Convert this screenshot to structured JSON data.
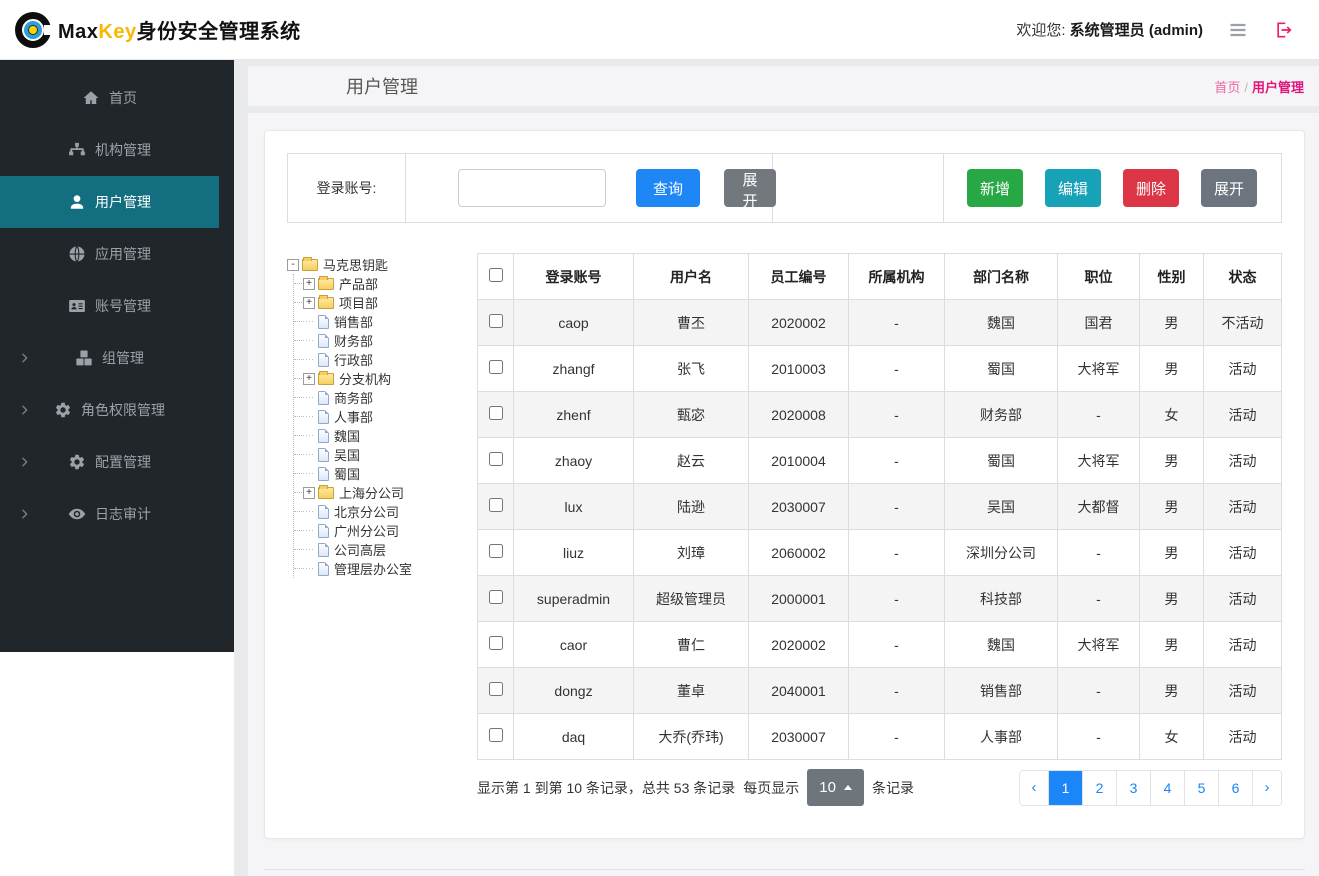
{
  "header": {
    "brand": {
      "max": "Max",
      "key": "Key",
      "suffix": "身份安全管理系统"
    },
    "welcome_label": "欢迎您:",
    "user_display": "系统管理员 (admin)"
  },
  "sidebar": {
    "active_color": "#136f80",
    "items": [
      {
        "name": "home",
        "label": "首页",
        "icon": "home-icon",
        "active": false,
        "chevron": false
      },
      {
        "name": "org",
        "label": "机构管理",
        "icon": "sitemap-icon",
        "active": false,
        "chevron": false
      },
      {
        "name": "user",
        "label": "用户管理",
        "icon": "user-icon",
        "active": true,
        "chevron": false
      },
      {
        "name": "app",
        "label": "应用管理",
        "icon": "globe-icon",
        "active": false,
        "chevron": false
      },
      {
        "name": "account",
        "label": "账号管理",
        "icon": "id-card-icon",
        "active": false,
        "chevron": false
      },
      {
        "name": "group",
        "label": "组管理",
        "icon": "cubes-icon",
        "active": false,
        "chevron": true
      },
      {
        "name": "role",
        "label": "角色权限管理",
        "icon": "gears-icon",
        "active": false,
        "chevron": true
      },
      {
        "name": "config",
        "label": "配置管理",
        "icon": "gears-icon",
        "active": false,
        "chevron": true
      },
      {
        "name": "audit",
        "label": "日志审计",
        "icon": "eye-icon",
        "active": false,
        "chevron": true
      }
    ]
  },
  "page": {
    "title": "用户管理",
    "breadcrumb": [
      "首页",
      "用户管理"
    ]
  },
  "search": {
    "label": "登录账号:",
    "input_value": "",
    "query_label": "查询",
    "toggle_label": "展开"
  },
  "toolbar": {
    "buttons": [
      {
        "name": "add-button",
        "label": "新增",
        "color": "#28a745"
      },
      {
        "name": "edit-button",
        "label": "编辑",
        "color": "#17a2b8"
      },
      {
        "name": "delete-button",
        "label": "删除",
        "color": "#dc3545"
      },
      {
        "name": "expand-button",
        "label": "展开",
        "color": "#6c757d"
      }
    ]
  },
  "tree": {
    "root": {
      "label": "马克思钥匙",
      "type": "folder",
      "expander": "minus"
    },
    "children": [
      {
        "label": "产品部",
        "type": "folder",
        "expander": "plus"
      },
      {
        "label": "项目部",
        "type": "folder",
        "expander": "plus"
      },
      {
        "label": "销售部",
        "type": "leaf",
        "expander": "none"
      },
      {
        "label": "财务部",
        "type": "leaf",
        "expander": "none"
      },
      {
        "label": "行政部",
        "type": "leaf",
        "expander": "none"
      },
      {
        "label": "分支机构",
        "type": "folder",
        "expander": "plus"
      },
      {
        "label": "商务部",
        "type": "leaf",
        "expander": "none"
      },
      {
        "label": "人事部",
        "type": "leaf",
        "expander": "none"
      },
      {
        "label": "魏国",
        "type": "leaf",
        "expander": "none"
      },
      {
        "label": "吴国",
        "type": "leaf",
        "expander": "none"
      },
      {
        "label": "蜀国",
        "type": "leaf",
        "expander": "none"
      },
      {
        "label": "上海分公司",
        "type": "folder",
        "expander": "plus"
      },
      {
        "label": "北京分公司",
        "type": "leaf",
        "expander": "none"
      },
      {
        "label": "广州分公司",
        "type": "leaf",
        "expander": "none"
      },
      {
        "label": "公司高层",
        "type": "leaf",
        "expander": "none"
      },
      {
        "label": "管理层办公室",
        "type": "leaf",
        "expander": "none"
      }
    ]
  },
  "table": {
    "columns": [
      "登录账号",
      "用户名",
      "员工编号",
      "所属机构",
      "部门名称",
      "职位",
      "性别",
      "状态"
    ],
    "rows": [
      [
        "caop",
        "曹丕",
        "2020002",
        "-",
        "魏国",
        "国君",
        "男",
        "不活动"
      ],
      [
        "zhangf",
        "张飞",
        "2010003",
        "-",
        "蜀国",
        "大将军",
        "男",
        "活动"
      ],
      [
        "zhenf",
        "甄宓",
        "2020008",
        "-",
        "财务部",
        "-",
        "女",
        "活动"
      ],
      [
        "zhaoy",
        "赵云",
        "2010004",
        "-",
        "蜀国",
        "大将军",
        "男",
        "活动"
      ],
      [
        "lux",
        "陆逊",
        "2030007",
        "-",
        "吴国",
        "大都督",
        "男",
        "活动"
      ],
      [
        "liuz",
        "刘璋",
        "2060002",
        "-",
        "深圳分公司",
        "-",
        "男",
        "活动"
      ],
      [
        "superadmin",
        "超级管理员",
        "2000001",
        "-",
        "科技部",
        "-",
        "男",
        "活动"
      ],
      [
        "caor",
        "曹仁",
        "2020002",
        "-",
        "魏国",
        "大将军",
        "男",
        "活动"
      ],
      [
        "dongz",
        "董卓",
        "2040001",
        "-",
        "销售部",
        "-",
        "男",
        "活动"
      ],
      [
        "daq",
        "大乔(乔玮)",
        "2030007",
        "-",
        "人事部",
        "-",
        "女",
        "活动"
      ]
    ]
  },
  "pagination": {
    "info_prefix": "显示第 1 到第 10 条记录，总共 53 条记录",
    "per_page_label": "每页显示",
    "page_size": "10",
    "records_label": "条记录",
    "prev": "‹",
    "next": "›",
    "pages": [
      "1",
      "2",
      "3",
      "4",
      "5",
      "6"
    ],
    "active_page": "1",
    "active_color": "#1a86f8"
  }
}
